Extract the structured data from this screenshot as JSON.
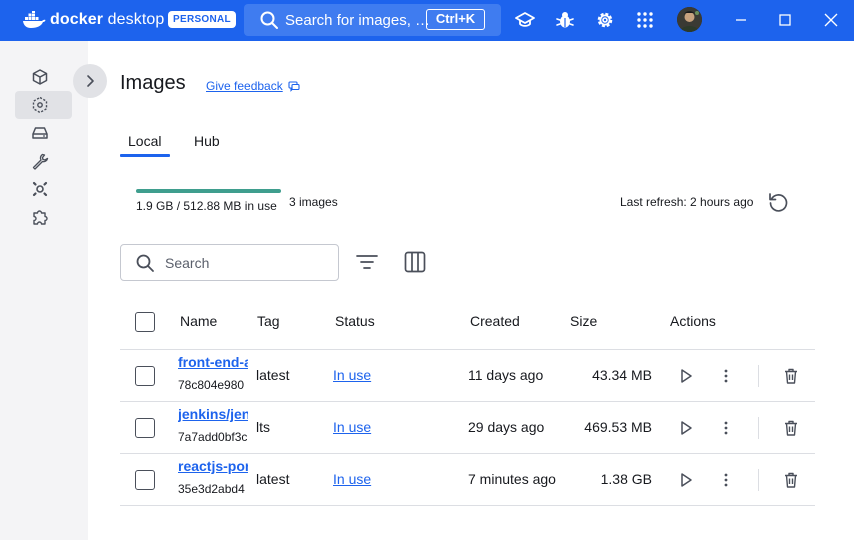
{
  "titlebar": {
    "app_name_bold": "docker",
    "app_name_light": " desktop",
    "plan_badge": "PERSONAL",
    "search_text": "Search for images, …",
    "search_shortcut": "Ctrl+K",
    "icons": [
      "docker-whale-icon",
      "search-icon",
      "learning-center-icon",
      "troubleshoot-bug-icon",
      "settings-gear-icon",
      "extensions-grid-icon",
      "user-avatar",
      "minimize-icon",
      "maximize-icon",
      "close-icon"
    ],
    "accent_color": "#1d63ed"
  },
  "sidebar": {
    "items": [
      {
        "icon": "containers-cube-icon",
        "active": false
      },
      {
        "icon": "images-icon",
        "active": true
      },
      {
        "icon": "volumes-drive-icon",
        "active": false
      },
      {
        "icon": "builds-wrench-icon",
        "active": false
      },
      {
        "icon": "docker-scout-icon",
        "active": false
      },
      {
        "icon": "extensions-puzzle-icon",
        "active": false
      }
    ],
    "collapse_icon": "chevron-right-icon"
  },
  "page": {
    "title": "Images",
    "feedback_link": "Give feedback",
    "tabs": [
      {
        "label": "Local",
        "active": true
      },
      {
        "label": "Hub",
        "active": false
      }
    ],
    "usage": "1.9 GB / 512.88 MB in use",
    "image_count": "3 images",
    "last_refresh": "Last refresh: 2 hours ago",
    "search_placeholder": "Search"
  },
  "table": {
    "columns": [
      "Name",
      "Tag",
      "Status",
      "Created",
      "Size",
      "Actions"
    ],
    "rows": [
      {
        "name": "front-end-a",
        "id": "78c804e980",
        "tag": "latest",
        "status": "In use",
        "created": "11 days ago",
        "size": "43.34 MB"
      },
      {
        "name": "jenkins/jen",
        "id": "7a7add0bf3c",
        "tag": "lts",
        "status": "In use",
        "created": "29 days ago",
        "size": "469.53 MB"
      },
      {
        "name": "reactjs-por",
        "id": "35e3d2abd4",
        "tag": "latest",
        "status": "In use",
        "created": "7 minutes ago",
        "size": "1.38 GB"
      }
    ]
  }
}
